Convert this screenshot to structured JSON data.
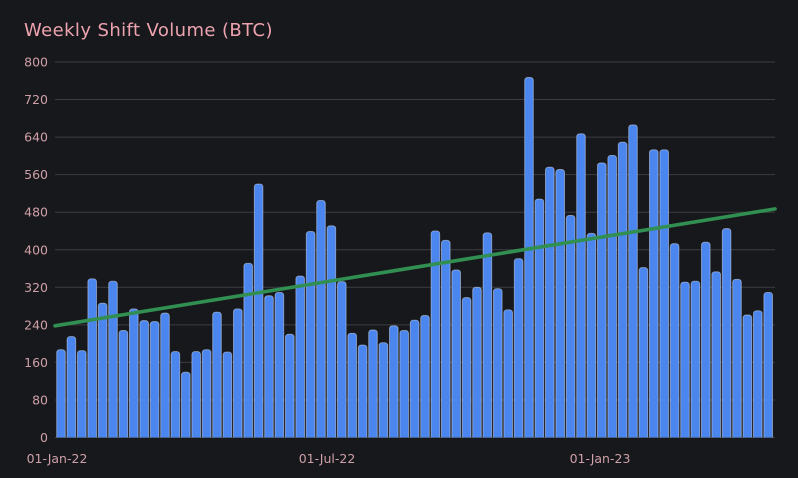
{
  "page": {
    "background": "#17181c"
  },
  "chart_data": {
    "type": "bar",
    "title": "Weekly Shift Volume (BTC)",
    "x_unit": "week",
    "n_bars": 69,
    "values": [
      187,
      215,
      185,
      338,
      286,
      333,
      228,
      274,
      249,
      247,
      265,
      183,
      139,
      183,
      187,
      267,
      182,
      274,
      371,
      540,
      302,
      309,
      220,
      344,
      439,
      505,
      451,
      332,
      222,
      197,
      229,
      202,
      238,
      228,
      250,
      260,
      440,
      420,
      357,
      298,
      320,
      436,
      317,
      272,
      381,
      767,
      508,
      576,
      571,
      473,
      647,
      435,
      585,
      601,
      629,
      666,
      362,
      613,
      613,
      413,
      331,
      333,
      416,
      353,
      445,
      337,
      261,
      270,
      309
    ],
    "x_tick_labels": [
      "01-Jan-22",
      "01-Jul-22",
      "01-Jan-23"
    ],
    "y_ticks": [
      0,
      80,
      160,
      240,
      320,
      400,
      480,
      560,
      640,
      720,
      800
    ],
    "ylim": [
      0,
      800
    ],
    "grid": true,
    "legend": false,
    "trend_line": {
      "type": "linear",
      "start_value": 238,
      "end_value": 487
    }
  },
  "colors": {
    "background": "#17181c",
    "gridline": "#3c3d42",
    "title_text": "#eda3af",
    "tick_text": "#cfa0a8",
    "bar_fill": "#4b86ee",
    "bar_outline": "#cdd8ee",
    "trend_green": "#318f52"
  }
}
